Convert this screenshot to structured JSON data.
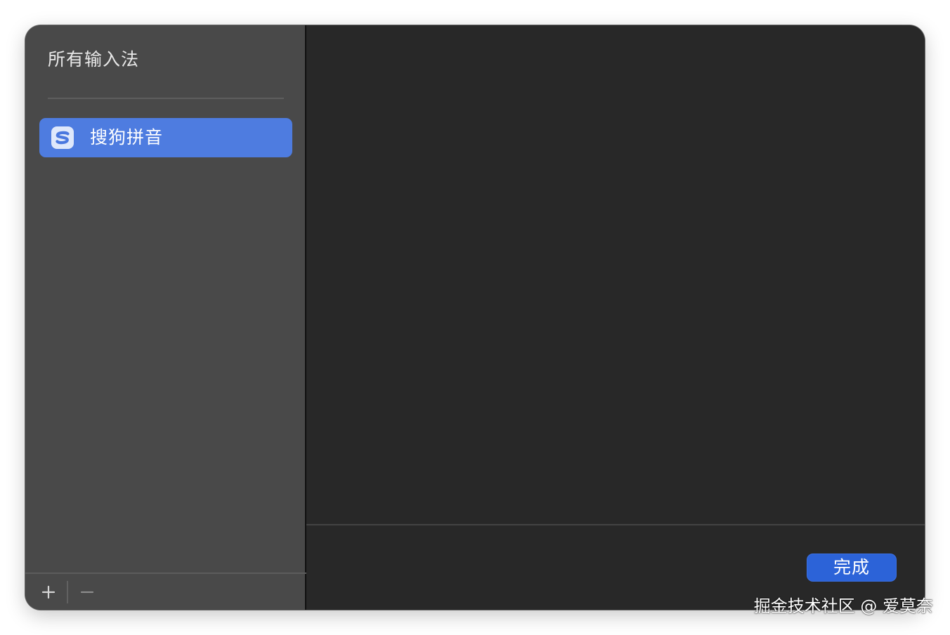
{
  "sidebar": {
    "title": "所有输入法",
    "items": [
      {
        "label": "搜狗拼音",
        "icon": "sogou-icon",
        "selected": true
      }
    ],
    "footer": {
      "add_label": "+",
      "remove_label": "−"
    }
  },
  "content": {
    "done_label": "完成"
  },
  "watermark": "掘金技术社区 @ 爱莫奈",
  "colors": {
    "sidebar_bg": "#494949",
    "content_bg": "#282828",
    "selected_item": "#4e7ce0",
    "primary_button": "#2c63d8",
    "icon_blue": "#4a78df"
  }
}
